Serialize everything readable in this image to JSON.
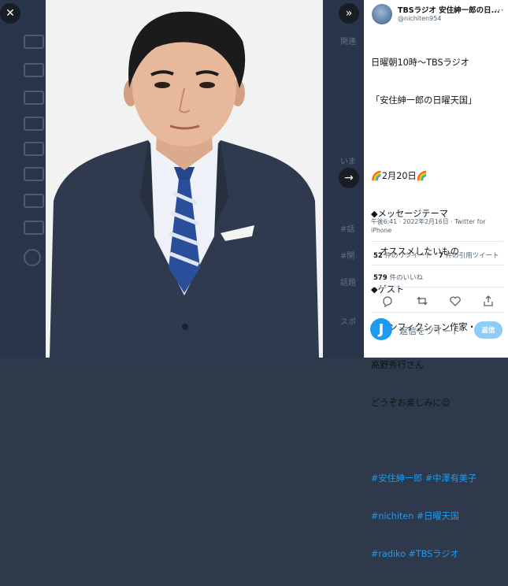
{
  "modal": {
    "close_icon": "close-icon",
    "expand_icon": "double-chevron-right-icon",
    "next_icon": "arrow-right-icon"
  },
  "tweet": {
    "author_name": "TBSラジオ 安住紳一郎の日...",
    "author_handle": "@nichiten954",
    "lines": [
      {
        "text": "日曜朝10時～TBSラジオ",
        "type": "text"
      },
      {
        "text": "「安住紳一郎の日曜天国」",
        "type": "text"
      },
      {
        "text": "",
        "type": "text"
      },
      {
        "text": "🌈2月20日🌈",
        "type": "text"
      },
      {
        "text": "◆メッセージテーマ",
        "type": "text"
      },
      {
        "text": "　オススメしたいもの",
        "type": "text"
      },
      {
        "text": "◆ゲスト",
        "type": "text"
      },
      {
        "text": "　ノンフィクション作家・",
        "type": "text"
      },
      {
        "text": "高野秀行さん",
        "type": "text"
      },
      {
        "text": "どうぞお楽しみに😌",
        "type": "text"
      },
      {
        "text": "",
        "type": "text"
      },
      {
        "text": "#安住紳一郎 #中澤有美子",
        "type": "tag"
      },
      {
        "text": "#nichiten #日曜天国",
        "type": "tag"
      },
      {
        "text": "#radiko #TBSラジオ",
        "type": "tag"
      }
    ],
    "timestamp": "午後6:41 · 2022年2月16日 · Twitter for iPhone",
    "retweets_count": "52",
    "retweets_label": "件のリツイート",
    "quotes_count": "7",
    "quotes_label": "件の引用ツイート",
    "likes_count": "579",
    "likes_label": "件のいいね"
  },
  "reply": {
    "placeholder": "返信をツイート",
    "button_label": "返信",
    "avatar_letter": "J"
  },
  "backdrop_text": [
    "関連",
    "いま",
    "#話",
    "#関",
    "話題",
    "スポ"
  ]
}
